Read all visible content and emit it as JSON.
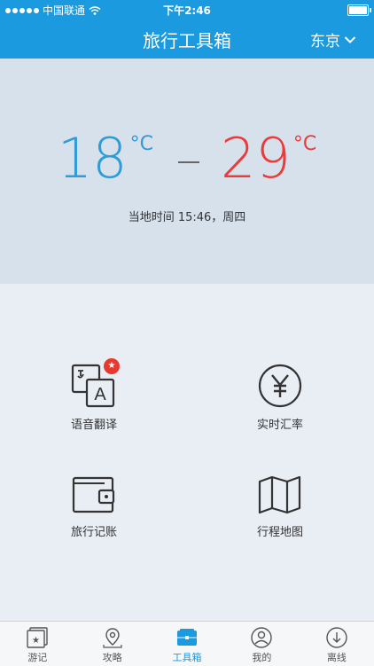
{
  "status": {
    "carrier": "中国联通",
    "time": "下午2:46"
  },
  "header": {
    "title": "旅行工具箱",
    "city": "东京"
  },
  "weather": {
    "low": "18",
    "high": "29",
    "unit": "°C",
    "local_time": "当地时间 15:46，周四"
  },
  "tools": [
    {
      "label": "语音翻译",
      "badge": "★"
    },
    {
      "label": "实时汇率"
    },
    {
      "label": "旅行记账"
    },
    {
      "label": "行程地图"
    }
  ],
  "tabs": [
    {
      "label": "游记"
    },
    {
      "label": "攻略"
    },
    {
      "label": "工具箱",
      "active": true
    },
    {
      "label": "我的"
    },
    {
      "label": "离线"
    }
  ],
  "colors": {
    "accent": "#1b9ae0",
    "low_temp": "#2f9bd9",
    "high_temp": "#ea3a3a"
  }
}
